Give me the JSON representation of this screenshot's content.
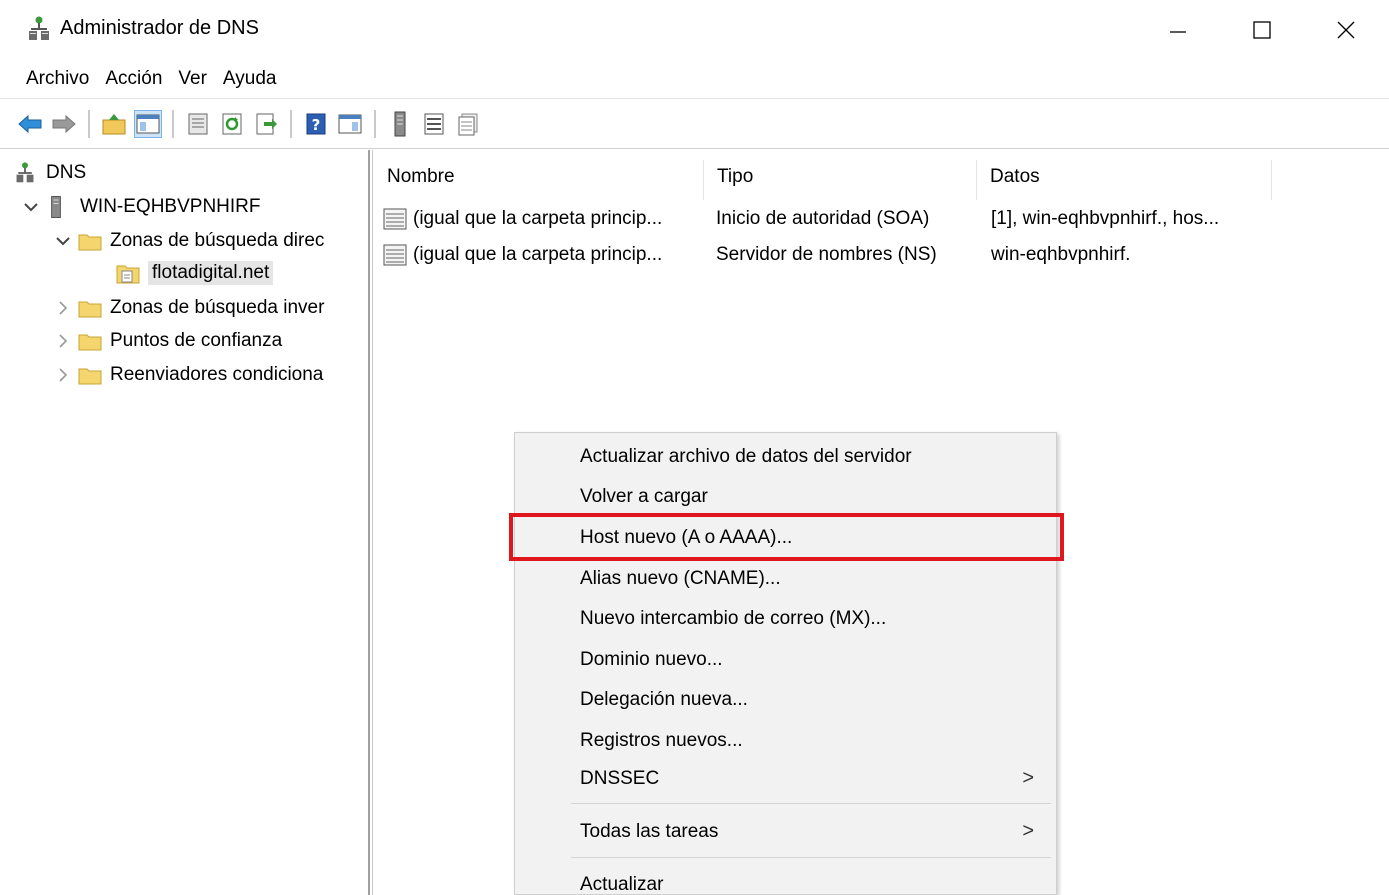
{
  "window": {
    "title": "Administrador de DNS",
    "minimize_glyph": "—",
    "maximize_glyph": "☐",
    "close_glyph": "✕"
  },
  "menu": {
    "items": [
      "Archivo",
      "Acción",
      "Ver",
      "Ayuda"
    ]
  },
  "toolbar": {
    "icons": [
      "back-icon",
      "forward-icon",
      "up-folder-icon",
      "show-hide-tree-icon",
      "properties-icon",
      "refresh-icon",
      "export-list-icon",
      "help-icon",
      "show-action-pane-icon",
      "server-icon",
      "list-icon",
      "details-icon"
    ]
  },
  "tree": {
    "root": "DNS",
    "server": "WIN-EQHBVPNHIRF",
    "forward_zones": "Zonas de búsqueda direc",
    "zone": "flotadigital.net",
    "reverse_zones": "Zonas de búsqueda inver",
    "trust_points": "Puntos de confianza",
    "conditional_forwarders": "Reenviadores condiciona"
  },
  "list": {
    "columns": [
      "Nombre",
      "Tipo",
      "Datos"
    ],
    "rows": [
      {
        "nombre": "(igual que la carpeta princip...",
        "tipo": "Inicio de autoridad (SOA)",
        "datos": "[1], win-eqhbvpnhirf., hos..."
      },
      {
        "nombre": "(igual que la carpeta princip...",
        "tipo": "Servidor de nombres (NS)",
        "datos": "win-eqhbvpnhirf."
      }
    ]
  },
  "context_menu": {
    "items": [
      "Actualizar archivo de datos del servidor",
      "Volver a cargar",
      "Host nuevo (A o AAAA)...",
      "Alias nuevo (CNAME)...",
      "Nuevo intercambio de correo (MX)...",
      "Dominio nuevo...",
      "Delegación nueva...",
      "Registros nuevos...",
      "DNSSEC",
      "Todas las tareas",
      "Actualizar"
    ],
    "submenu_glyph": ">",
    "highlighted_item": "Host nuevo (A o AAAA)...",
    "highlight_color": "#e0161e"
  }
}
